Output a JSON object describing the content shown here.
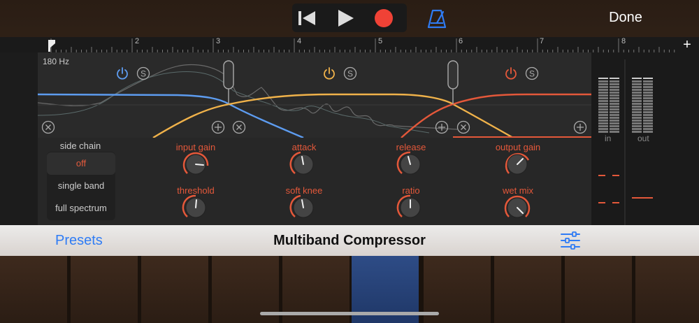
{
  "topbar": {
    "done_label": "Done"
  },
  "ruler": {
    "marks": [
      "2",
      "3",
      "4",
      "5",
      "6",
      "7",
      "8"
    ],
    "plus_label": "+"
  },
  "graph": {
    "freq_label": "180 Hz",
    "band_colors": [
      "#5d9cf0",
      "#f0b24a",
      "#e4583a"
    ]
  },
  "side_chain": {
    "title": "side chain",
    "options": [
      "off",
      "single band",
      "full spectrum"
    ],
    "selected": "off"
  },
  "knobs": {
    "input_gain": "input gain",
    "attack": "attack",
    "release": "release",
    "output_gain": "output gain",
    "threshold": "threshold",
    "soft_knee": "soft knee",
    "ratio": "ratio",
    "wet_mix": "wet mix"
  },
  "meters": {
    "in_label": "in",
    "out_label": "out"
  },
  "titlebar": {
    "presets_label": "Presets",
    "title": "Multiband Compressor"
  }
}
